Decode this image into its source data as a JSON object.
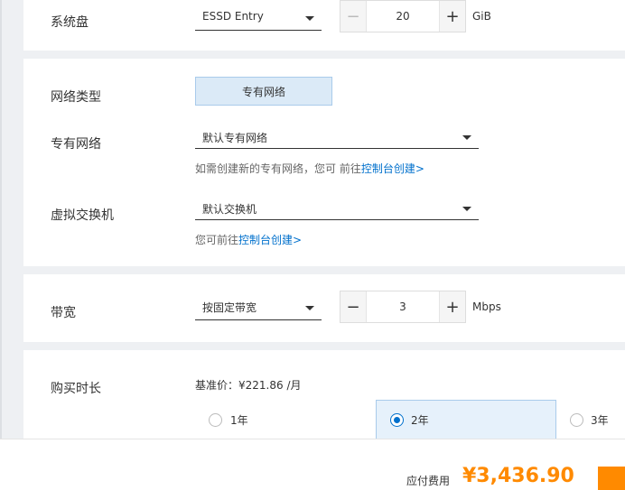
{
  "disk": {
    "label": "系统盘",
    "type": "ESSD Entry",
    "size": "20",
    "unit": "GiB"
  },
  "network": {
    "type_label": "网络类型",
    "type_value": "专有网络",
    "vpc_label": "专有网络",
    "vpc_value": "默认专有网络",
    "vpc_hint": "如需创建新的专有网络，您可 前往",
    "vpc_link": "控制台创建>",
    "vswitch_label": "虚拟交换机",
    "vswitch_value": "默认交换机",
    "vswitch_hint": "您可前往",
    "vswitch_link": "控制台创建>"
  },
  "bandwidth": {
    "label": "带宽",
    "mode": "按固定带宽",
    "value": "3",
    "unit": "Mbps"
  },
  "duration": {
    "label": "购买时长",
    "base_price": "基准价：¥221.86 /月",
    "options": [
      "1年",
      "2年",
      "3年"
    ],
    "selected": "2年"
  },
  "footer": {
    "fee_label": "应付费用",
    "fee_value": "¥3,436.90"
  },
  "colors": {
    "accent": "#0070cc",
    "price": "#ff8a00",
    "selected_bg": "#e6f1fb"
  }
}
